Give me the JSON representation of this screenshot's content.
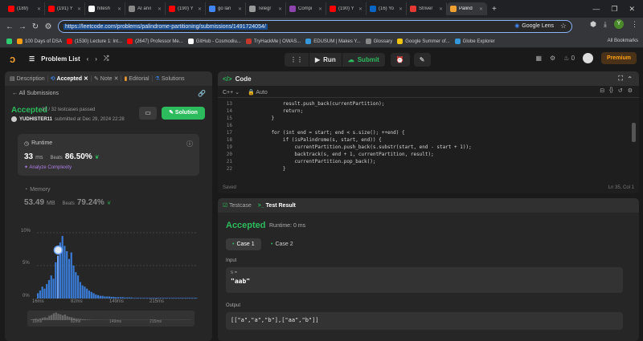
{
  "browser": {
    "tabs": [
      {
        "label": "(189)",
        "color": "#ff0000"
      },
      {
        "label": "(191) Y",
        "color": "#ff0000"
      },
      {
        "label": "hitesh",
        "color": "#ffffff"
      },
      {
        "label": "AI arvi",
        "color": "#888888"
      },
      {
        "label": "(190) Y",
        "color": "#ff0000"
      },
      {
        "label": "go lan",
        "color": "#4285f4"
      },
      {
        "label": "Telegr",
        "color": "#999999"
      },
      {
        "label": "Compi",
        "color": "#8e44ad"
      },
      {
        "label": "(190) Y",
        "color": "#ff0000"
      },
      {
        "label": "(16) Yo",
        "color": "#0a66c2"
      },
      {
        "label": "Striver",
        "color": "#e53935"
      },
      {
        "label": "Palind",
        "color": "#f0a030",
        "active": true
      }
    ],
    "new_tab": "+",
    "url": "https://leetcode.com/problems/palindrome-partitioning/submissions/1491724054/",
    "lens": "Google Lens",
    "profile_initial": "Y",
    "bookmarks": [
      {
        "label": "",
        "color": "#2ecc71"
      },
      {
        "label": "100 Days of DSA",
        "color": "#f39c12"
      },
      {
        "label": "(1530) Lecture 1: Int...",
        "color": "#ff0000"
      },
      {
        "label": "(2647) Professor Me...",
        "color": "#ff0000"
      },
      {
        "label": "GitHub - Cosmodiu...",
        "color": "#ffffff"
      },
      {
        "label": "TryHackMe | OWAS...",
        "color": "#c0392b"
      },
      {
        "label": "EDUSUM | Makes Y...",
        "color": "#3498db"
      },
      {
        "label": "Glossary",
        "color": "#888888"
      },
      {
        "label": "Google Summer of...",
        "color": "#f1c40f"
      },
      {
        "label": "Globe Explorer",
        "color": "#3498db"
      }
    ],
    "all_bookmarks": "All Bookmarks"
  },
  "header": {
    "problem_list": "Problem List",
    "run": "Run",
    "submit": "Submit",
    "fire_count": "0",
    "premium": "Premium"
  },
  "left": {
    "tabs": [
      "Description",
      "Accepted",
      "Note",
      "Editorial",
      "Solutions"
    ],
    "all_submissions": "All Submissions",
    "status": "Accepted",
    "testcases": "32 / 32 testcases passed",
    "author": "YUDHISTER11",
    "submitted": "submitted at Dec 29, 2024 22:28",
    "solution_btn": "Solution",
    "runtime_label": "Runtime",
    "runtime_value": "33",
    "runtime_unit": "ms",
    "beats": "Beats",
    "runtime_beats": "86.50%",
    "analyze": "Analyze Complexity",
    "memory_label": "Memory",
    "memory_value": "53.49",
    "memory_unit": "MB",
    "memory_beats": "79.24%"
  },
  "chart_data": {
    "type": "bar",
    "ylim": [
      0,
      10
    ],
    "y_ticks": [
      "10%",
      "5%",
      "0%"
    ],
    "x_ticks": [
      "16ms",
      "82ms",
      "149ms",
      "215ms"
    ],
    "values": [
      0.8,
      1.2,
      1.8,
      1.5,
      2.2,
      2.8,
      3.5,
      3.0,
      5.5,
      6.5,
      8.5,
      9.5,
      8.0,
      7.2,
      6.0,
      7.0,
      5.0,
      4.0,
      3.5,
      2.5,
      2.0,
      1.8,
      1.5,
      1.2,
      1.0,
      0.8,
      0.6,
      0.5,
      0.4,
      0.4,
      0.3,
      0.3,
      0.3,
      0.25,
      0.25,
      0.2,
      0.2,
      0.2,
      0.2,
      0.15,
      0.15,
      0.15,
      0.15,
      0.1,
      0.1,
      0.1,
      0.1,
      0.1,
      0.1,
      0.1,
      0.1,
      0.1,
      0.1,
      0.1,
      0.1,
      0.1,
      0.1,
      0.1,
      0.1,
      0.1,
      0.1,
      0.1,
      0.1,
      0.1,
      0.1,
      0.1,
      0.1,
      0.1,
      0.1,
      0.1,
      0.1,
      0.1
    ],
    "highlight_index": 9,
    "colors": {
      "bar": "#3a7bd5",
      "highlight": "#6aa0f8",
      "grid": "#444444"
    }
  },
  "code": {
    "title": "Code",
    "language": "C++",
    "mode": "Auto",
    "lines": [
      {
        "n": "13",
        "t": "        result.push_back(currentPartition);"
      },
      {
        "n": "14",
        "t": "        return;"
      },
      {
        "n": "15",
        "t": "    }"
      },
      {
        "n": "16",
        "t": ""
      },
      {
        "n": "17",
        "t": "    for (int end = start; end < s.size(); ++end) {"
      },
      {
        "n": "18",
        "t": "        if (isPalindrome(s, start, end)) {"
      },
      {
        "n": "19",
        "t": "            currentPartition.push_back(s.substr(start, end - start + 1));"
      },
      {
        "n": "20",
        "t": "            backtrack(s, end + 1, currentPartition, result);"
      },
      {
        "n": "21",
        "t": "            currentPartition.pop_back();"
      },
      {
        "n": "22",
        "t": "        }"
      }
    ],
    "saved": "Saved",
    "cursor": "Ln 35, Col 1"
  },
  "result": {
    "testcase_tab": "Testcase",
    "result_tab": "Test Result",
    "status": "Accepted",
    "runtime": "Runtime: 0 ms",
    "case1": "Case 1",
    "case2": "Case 2",
    "input_label": "Input",
    "input_var": "s =",
    "input_value": "\"aab\"",
    "output_label": "Output",
    "output_value": "[[\"a\",\"a\",\"b\"],[\"aa\",\"b\"]]"
  }
}
